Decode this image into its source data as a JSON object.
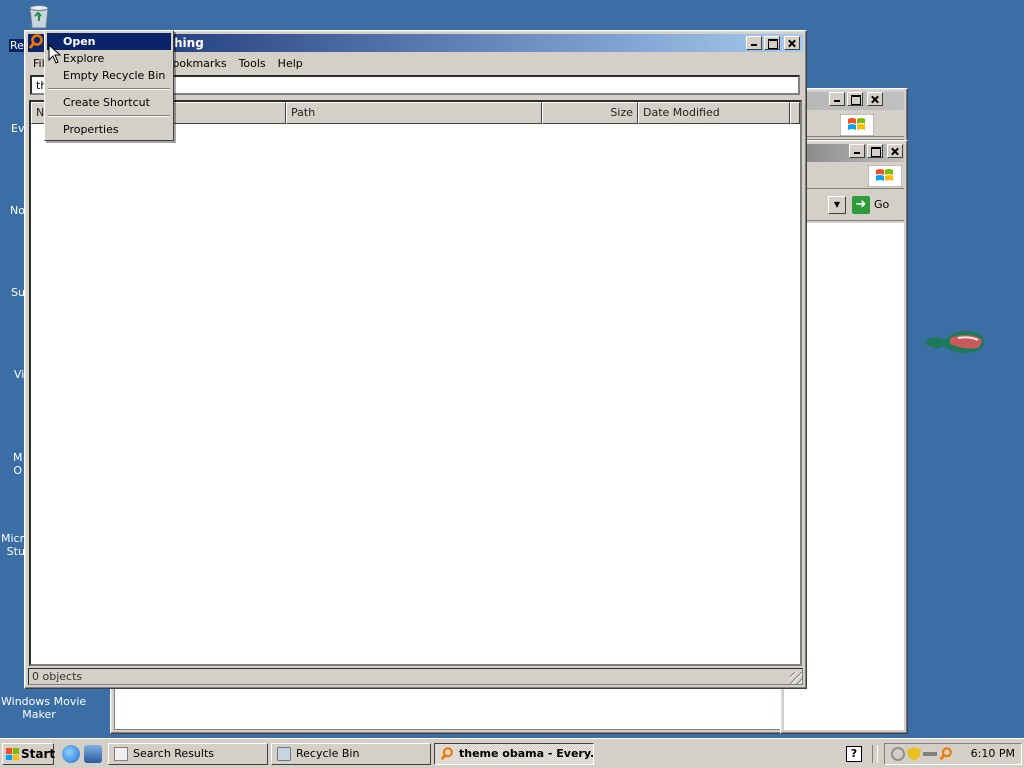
{
  "desktop": {
    "icons": [
      {
        "label": "Re"
      },
      {
        "label": "Ev"
      },
      {
        "label": "No"
      },
      {
        "label": "Su"
      },
      {
        "label": "Vi"
      },
      {
        "label": "M\nO"
      },
      {
        "label": "Micro\nStu"
      },
      {
        "label": "Windows Movie\nMaker"
      }
    ]
  },
  "back_window_2": {
    "go_label": "Go"
  },
  "main_window": {
    "title": "hing",
    "menu": [
      "Fil",
      "ookmarks",
      "Tools",
      "Help"
    ],
    "search_value": "th",
    "columns": [
      "Na",
      "Path",
      "Size",
      "Date Modified"
    ],
    "status": "0 objects"
  },
  "context_menu": {
    "items": [
      "Open",
      "Explore",
      "Empty Recycle Bin",
      "Create Shortcut",
      "Properties"
    ]
  },
  "taskbar": {
    "start_label": "Start",
    "tasks": [
      "Search Results",
      "Recycle Bin",
      "theme obama - Every..."
    ],
    "help_label": "?",
    "clock": "6:10 PM"
  },
  "colors": {
    "desktop": "#3a6ea5",
    "title_active": "#0a246a",
    "menu_highlight": "#0a246a"
  }
}
